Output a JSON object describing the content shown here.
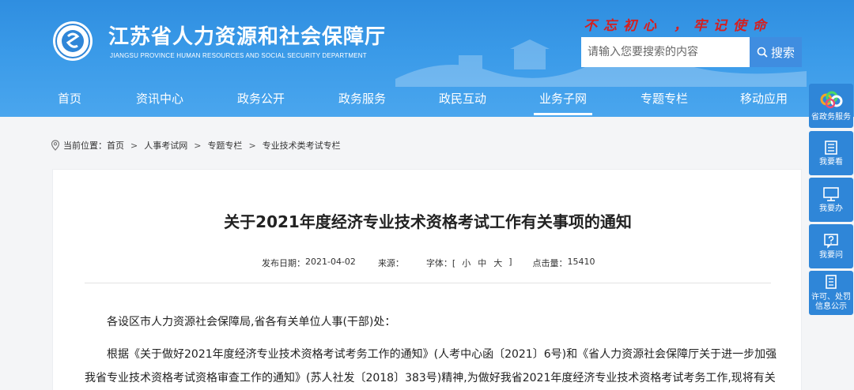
{
  "header": {
    "title": "江苏省人力资源和社会保障厅",
    "subtitle": "JIANGSU PROVINCE HUMAN RESOURCES AND SOCIAL SECURITY DEPARTMENT",
    "slogan": "不忘初心 ，牢记使命",
    "brand_color": "#3a9ae8",
    "slogan_color": "#d51f1f"
  },
  "search": {
    "placeholder": "请输入您要搜索的内容",
    "button_label": "搜索",
    "icon": "search-icon"
  },
  "nav": {
    "items": [
      {
        "label": "首页",
        "active": false
      },
      {
        "label": "资讯中心",
        "active": false
      },
      {
        "label": "政务公开",
        "active": false
      },
      {
        "label": "政务服务",
        "active": false
      },
      {
        "label": "政民互动",
        "active": false
      },
      {
        "label": "业务子网",
        "active": true
      },
      {
        "label": "专题专栏",
        "active": false
      },
      {
        "label": "移动应用",
        "active": false
      }
    ]
  },
  "breadcrumb": {
    "prefix": "当前位置：",
    "icon": "location-pin-icon",
    "items": [
      "首页",
      "人事考试网",
      "专题专栏",
      "专业技术类考试专栏"
    ],
    "separator": ">"
  },
  "article": {
    "title": "关于2021年度经济专业技术资格考试工作有关事项的通知",
    "meta": {
      "date_label": "发布日期：",
      "date": "2021-04-02",
      "source_label": "来源：",
      "source": "",
      "font_label": "字体：[",
      "font_small": "小",
      "font_medium": "中",
      "font_large": "大",
      "font_close": "]",
      "views_label": "点击量：",
      "views": "15410"
    },
    "salutation": "各设区市人力资源社会保障局,省各有关单位人事(干部)处：",
    "body_line1": "根据《关于做好2021年度经济专业技术资格考试考务工作的通知》(人考中心函〔2021〕6号)和《省人力资源社会保障厅关于进一步加强",
    "body_line2": "我省专业技术资格考试资格审查工作的通知》(苏人社发〔2018〕383号)精神,为做好我省2021年度经济专业技术资格考试考务工作,现将有关"
  },
  "side_buttons": [
    {
      "label": "省政务服务",
      "icon": "gov-service-logo-icon"
    },
    {
      "label": "我要看",
      "icon": "book-icon"
    },
    {
      "label": "我要办",
      "icon": "monitor-icon"
    },
    {
      "label": "我要问",
      "icon": "question-icon"
    },
    {
      "label": "许可、处罚信息公示",
      "icon": "document-list-icon"
    }
  ]
}
